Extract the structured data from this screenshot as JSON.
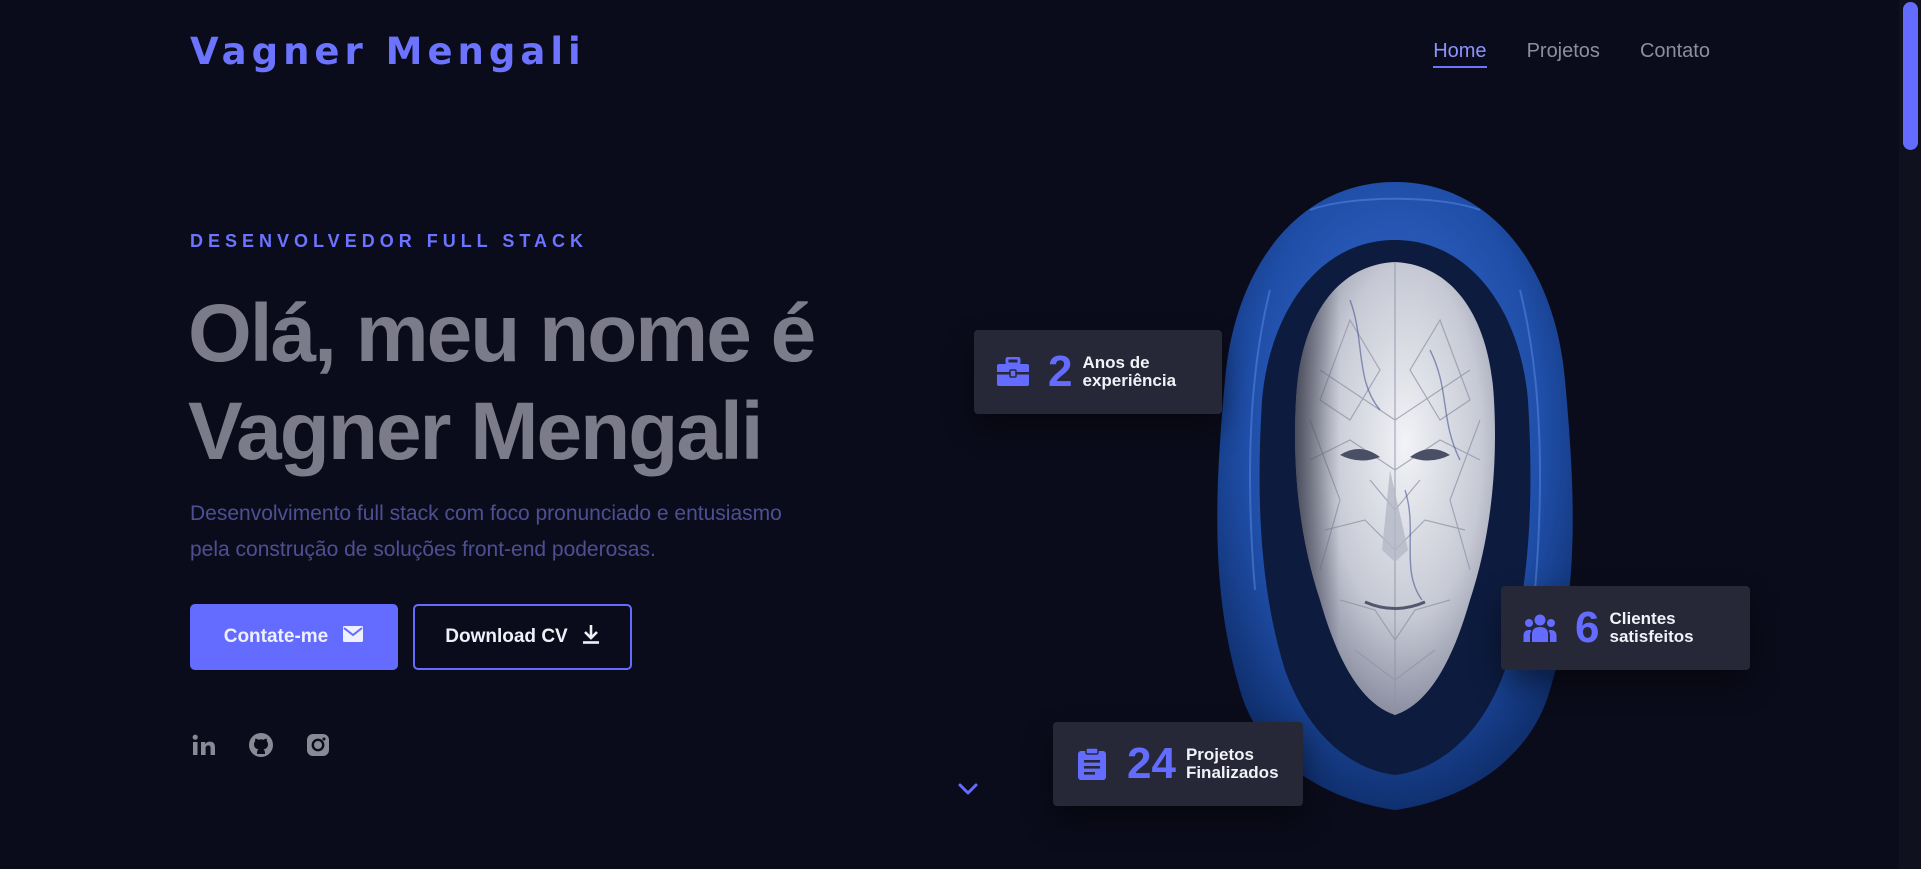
{
  "header": {
    "logo": "Vagner Mengali",
    "nav": [
      {
        "label": "Home",
        "active": true
      },
      {
        "label": "Projetos",
        "active": false
      },
      {
        "label": "Contato",
        "active": false
      }
    ]
  },
  "hero": {
    "eyebrow": "DESENVOLVEDOR FULL STACK",
    "headline_line1": "Olá, meu nome é",
    "headline_line2": "Vagner Mengali",
    "intro_line1": "Desenvolvimento full stack com foco pronunciado e entusiasmo",
    "intro_line2": "pela construção de soluções front-end poderosas.",
    "primary_button": {
      "label": "Contate-me",
      "icon": "mail-icon"
    },
    "secondary_button": {
      "label": "Download CV",
      "icon": "download-icon"
    },
    "socials": [
      {
        "name": "linkedin-icon"
      },
      {
        "name": "github-icon"
      },
      {
        "name": "instagram-icon"
      }
    ],
    "scroll_icon": "chevron-down-icon"
  },
  "stats": {
    "experience": {
      "number": "2",
      "label_line1": "Anos de",
      "label_line2": "experiência",
      "icon": "briefcase-icon"
    },
    "clients": {
      "number": "6",
      "label_line1": "Clientes",
      "label_line2": "satisfeitos",
      "icon": "users-icon"
    },
    "projects": {
      "number": "24",
      "label_line1": "Projetos",
      "label_line2": "Finalizados",
      "icon": "clipboard-icon"
    }
  },
  "colors": {
    "background": "#0b0c1b",
    "accent": "#646cff",
    "headline": "#7b7b89",
    "card": "#262838"
  }
}
